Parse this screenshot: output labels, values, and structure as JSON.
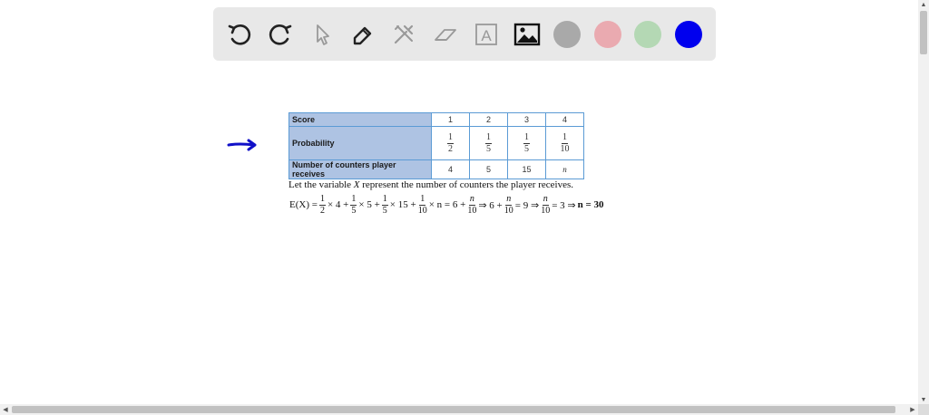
{
  "toolbar": {
    "tools": [
      {
        "name": "undo-icon"
      },
      {
        "name": "redo-icon"
      },
      {
        "name": "pointer-icon"
      },
      {
        "name": "pen-icon"
      },
      {
        "name": "tools-icon"
      },
      {
        "name": "eraser-icon"
      },
      {
        "name": "text-icon",
        "label": "A"
      },
      {
        "name": "image-icon"
      }
    ],
    "swatches": [
      {
        "name": "gray",
        "color": "#a9a9a9"
      },
      {
        "name": "pink",
        "color": "#eaaab0"
      },
      {
        "name": "green",
        "color": "#b4d8b4"
      },
      {
        "name": "blue",
        "color": "#0000ee"
      }
    ]
  },
  "annotation": {
    "color": "#1010c8"
  },
  "table": {
    "row_score": {
      "label": "Score",
      "values": [
        "1",
        "2",
        "3",
        "4"
      ]
    },
    "row_probability": {
      "label": "Probability",
      "fractions": [
        {
          "num": "1",
          "den": "2"
        },
        {
          "num": "1",
          "den": "5"
        },
        {
          "num": "1",
          "den": "5"
        },
        {
          "num": "1",
          "den": "10"
        }
      ]
    },
    "row_counters": {
      "label": "Number of counters player receives",
      "values": [
        "4",
        "5",
        "15",
        "n"
      ]
    }
  },
  "text": {
    "sentence_pre": "Let the variable ",
    "sentence_var": "X",
    "sentence_post": " represent the number of counters the player receives."
  },
  "equation": {
    "lhs": "E(X) =",
    "f1": {
      "num": "1",
      "den": "2"
    },
    "t1": "× 4 +",
    "f2": {
      "num": "1",
      "den": "5"
    },
    "t2": "× 5 +",
    "f3": {
      "num": "1",
      "den": "5"
    },
    "t3": "× 15 +",
    "f4": {
      "num": "1",
      "den": "10"
    },
    "t4": "× n = 6 +",
    "f5": {
      "num": "n",
      "den": "10"
    },
    "t5": "⇒ 6 +",
    "f6": {
      "num": "n",
      "den": "10"
    },
    "t6": "= 9 ⇒",
    "f7": {
      "num": "n",
      "den": "10"
    },
    "t7": "= 3 ⇒",
    "t8": "n = 30"
  }
}
